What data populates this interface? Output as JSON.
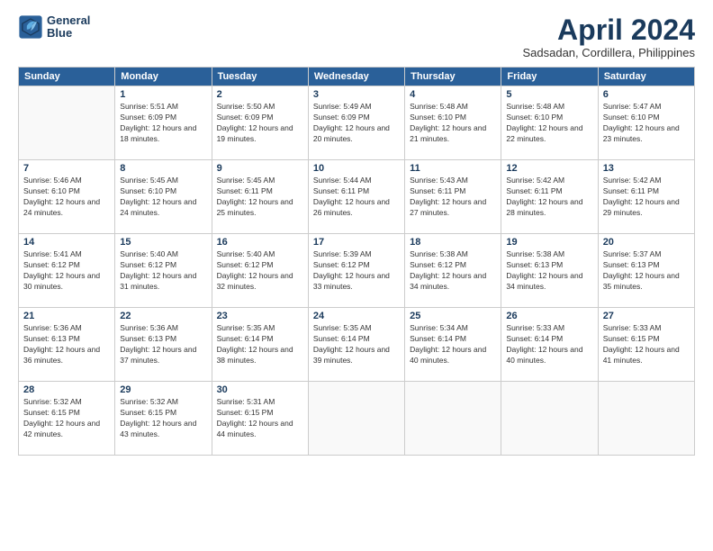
{
  "header": {
    "logo_line1": "General",
    "logo_line2": "Blue",
    "month": "April 2024",
    "location": "Sadsadan, Cordillera, Philippines"
  },
  "weekdays": [
    "Sunday",
    "Monday",
    "Tuesday",
    "Wednesday",
    "Thursday",
    "Friday",
    "Saturday"
  ],
  "weeks": [
    [
      {
        "day": null,
        "sunrise": "",
        "sunset": "",
        "daylight": ""
      },
      {
        "day": "1",
        "sunrise": "Sunrise: 5:51 AM",
        "sunset": "Sunset: 6:09 PM",
        "daylight": "Daylight: 12 hours and 18 minutes."
      },
      {
        "day": "2",
        "sunrise": "Sunrise: 5:50 AM",
        "sunset": "Sunset: 6:09 PM",
        "daylight": "Daylight: 12 hours and 19 minutes."
      },
      {
        "day": "3",
        "sunrise": "Sunrise: 5:49 AM",
        "sunset": "Sunset: 6:09 PM",
        "daylight": "Daylight: 12 hours and 20 minutes."
      },
      {
        "day": "4",
        "sunrise": "Sunrise: 5:48 AM",
        "sunset": "Sunset: 6:10 PM",
        "daylight": "Daylight: 12 hours and 21 minutes."
      },
      {
        "day": "5",
        "sunrise": "Sunrise: 5:48 AM",
        "sunset": "Sunset: 6:10 PM",
        "daylight": "Daylight: 12 hours and 22 minutes."
      },
      {
        "day": "6",
        "sunrise": "Sunrise: 5:47 AM",
        "sunset": "Sunset: 6:10 PM",
        "daylight": "Daylight: 12 hours and 23 minutes."
      }
    ],
    [
      {
        "day": "7",
        "sunrise": "Sunrise: 5:46 AM",
        "sunset": "Sunset: 6:10 PM",
        "daylight": "Daylight: 12 hours and 24 minutes."
      },
      {
        "day": "8",
        "sunrise": "Sunrise: 5:45 AM",
        "sunset": "Sunset: 6:10 PM",
        "daylight": "Daylight: 12 hours and 24 minutes."
      },
      {
        "day": "9",
        "sunrise": "Sunrise: 5:45 AM",
        "sunset": "Sunset: 6:11 PM",
        "daylight": "Daylight: 12 hours and 25 minutes."
      },
      {
        "day": "10",
        "sunrise": "Sunrise: 5:44 AM",
        "sunset": "Sunset: 6:11 PM",
        "daylight": "Daylight: 12 hours and 26 minutes."
      },
      {
        "day": "11",
        "sunrise": "Sunrise: 5:43 AM",
        "sunset": "Sunset: 6:11 PM",
        "daylight": "Daylight: 12 hours and 27 minutes."
      },
      {
        "day": "12",
        "sunrise": "Sunrise: 5:42 AM",
        "sunset": "Sunset: 6:11 PM",
        "daylight": "Daylight: 12 hours and 28 minutes."
      },
      {
        "day": "13",
        "sunrise": "Sunrise: 5:42 AM",
        "sunset": "Sunset: 6:11 PM",
        "daylight": "Daylight: 12 hours and 29 minutes."
      }
    ],
    [
      {
        "day": "14",
        "sunrise": "Sunrise: 5:41 AM",
        "sunset": "Sunset: 6:12 PM",
        "daylight": "Daylight: 12 hours and 30 minutes."
      },
      {
        "day": "15",
        "sunrise": "Sunrise: 5:40 AM",
        "sunset": "Sunset: 6:12 PM",
        "daylight": "Daylight: 12 hours and 31 minutes."
      },
      {
        "day": "16",
        "sunrise": "Sunrise: 5:40 AM",
        "sunset": "Sunset: 6:12 PM",
        "daylight": "Daylight: 12 hours and 32 minutes."
      },
      {
        "day": "17",
        "sunrise": "Sunrise: 5:39 AM",
        "sunset": "Sunset: 6:12 PM",
        "daylight": "Daylight: 12 hours and 33 minutes."
      },
      {
        "day": "18",
        "sunrise": "Sunrise: 5:38 AM",
        "sunset": "Sunset: 6:12 PM",
        "daylight": "Daylight: 12 hours and 34 minutes."
      },
      {
        "day": "19",
        "sunrise": "Sunrise: 5:38 AM",
        "sunset": "Sunset: 6:13 PM",
        "daylight": "Daylight: 12 hours and 34 minutes."
      },
      {
        "day": "20",
        "sunrise": "Sunrise: 5:37 AM",
        "sunset": "Sunset: 6:13 PM",
        "daylight": "Daylight: 12 hours and 35 minutes."
      }
    ],
    [
      {
        "day": "21",
        "sunrise": "Sunrise: 5:36 AM",
        "sunset": "Sunset: 6:13 PM",
        "daylight": "Daylight: 12 hours and 36 minutes."
      },
      {
        "day": "22",
        "sunrise": "Sunrise: 5:36 AM",
        "sunset": "Sunset: 6:13 PM",
        "daylight": "Daylight: 12 hours and 37 minutes."
      },
      {
        "day": "23",
        "sunrise": "Sunrise: 5:35 AM",
        "sunset": "Sunset: 6:14 PM",
        "daylight": "Daylight: 12 hours and 38 minutes."
      },
      {
        "day": "24",
        "sunrise": "Sunrise: 5:35 AM",
        "sunset": "Sunset: 6:14 PM",
        "daylight": "Daylight: 12 hours and 39 minutes."
      },
      {
        "day": "25",
        "sunrise": "Sunrise: 5:34 AM",
        "sunset": "Sunset: 6:14 PM",
        "daylight": "Daylight: 12 hours and 40 minutes."
      },
      {
        "day": "26",
        "sunrise": "Sunrise: 5:33 AM",
        "sunset": "Sunset: 6:14 PM",
        "daylight": "Daylight: 12 hours and 40 minutes."
      },
      {
        "day": "27",
        "sunrise": "Sunrise: 5:33 AM",
        "sunset": "Sunset: 6:15 PM",
        "daylight": "Daylight: 12 hours and 41 minutes."
      }
    ],
    [
      {
        "day": "28",
        "sunrise": "Sunrise: 5:32 AM",
        "sunset": "Sunset: 6:15 PM",
        "daylight": "Daylight: 12 hours and 42 minutes."
      },
      {
        "day": "29",
        "sunrise": "Sunrise: 5:32 AM",
        "sunset": "Sunset: 6:15 PM",
        "daylight": "Daylight: 12 hours and 43 minutes."
      },
      {
        "day": "30",
        "sunrise": "Sunrise: 5:31 AM",
        "sunset": "Sunset: 6:15 PM",
        "daylight": "Daylight: 12 hours and 44 minutes."
      },
      {
        "day": null,
        "sunrise": "",
        "sunset": "",
        "daylight": ""
      },
      {
        "day": null,
        "sunrise": "",
        "sunset": "",
        "daylight": ""
      },
      {
        "day": null,
        "sunrise": "",
        "sunset": "",
        "daylight": ""
      },
      {
        "day": null,
        "sunrise": "",
        "sunset": "",
        "daylight": ""
      }
    ]
  ]
}
